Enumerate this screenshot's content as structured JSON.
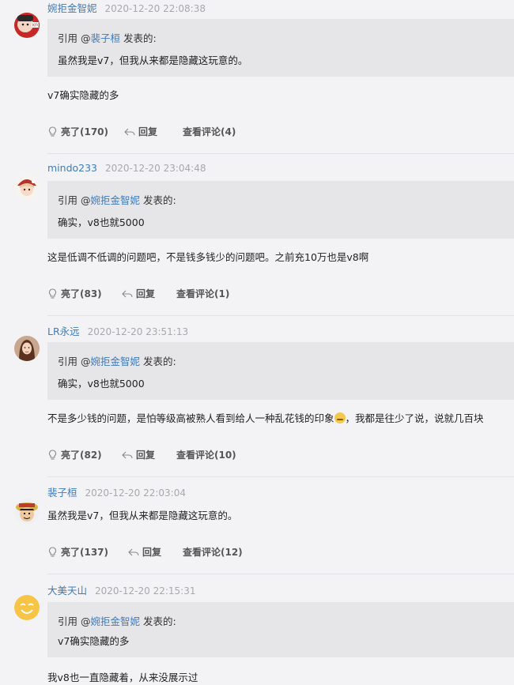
{
  "comments": [
    {
      "username": "婉拒金智妮",
      "time": "2020-12-20 22:08:38",
      "quote_prefix": "引用 @",
      "quote_user": "裴子桓",
      "quote_suffix": " 发表的:",
      "quote_text": "虽然我是v7，但我从来都是隐藏这玩意的。",
      "body": "v7确实隐藏的多",
      "like": "亮了(170)",
      "reply": "回复",
      "view": "查看评论(4)"
    },
    {
      "username": "mindo233",
      "time": "2020-12-20 23:04:48",
      "quote_prefix": "引用 @",
      "quote_user": "婉拒金智妮",
      "quote_suffix": " 发表的:",
      "quote_text": "确实，v8也就5000",
      "body": "这是低调不低调的问题吧，不是钱多钱少的问题吧。之前充10万也是v8啊",
      "like": "亮了(83)",
      "reply": "回复",
      "view": "查看评论(1)"
    },
    {
      "username": "LR永远",
      "time": "2020-12-20 23:51:13",
      "quote_prefix": "引用 @",
      "quote_user": "婉拒金智妮",
      "quote_suffix": " 发表的:",
      "quote_text": "确实，v8也就5000",
      "body_a": "不是多少钱的问题，是怕等级高被熟人看到给人一种乱花钱的印象",
      "body_b": "，我都是往少了说，说就几百块",
      "like": "亮了(82)",
      "reply": "回复",
      "view": "查看评论(10)"
    },
    {
      "username": "裴子桓",
      "time": "2020-12-20 22:03:04",
      "body": "虽然我是v7，但我从来都是隐藏这玩意的。",
      "like": "亮了(137)",
      "reply": "回复",
      "view": "查看评论(12)"
    },
    {
      "username": "大美天山",
      "time": "2020-12-20 22:15:31",
      "quote_prefix": "引用 @",
      "quote_user": "婉拒金智妮",
      "quote_suffix": " 发表的:",
      "quote_text": "v7确实隐藏的多",
      "body": "我v8也一直隐藏着，从来没展示过"
    }
  ],
  "colors": {
    "background": "#f3f3f5",
    "quote_bg": "#e6e6e9",
    "link": "#3f7bbf",
    "timestamp": "#a8a8ae"
  },
  "icons": {
    "like": "lightbulb-icon",
    "reply": "reply-arrow-icon"
  }
}
